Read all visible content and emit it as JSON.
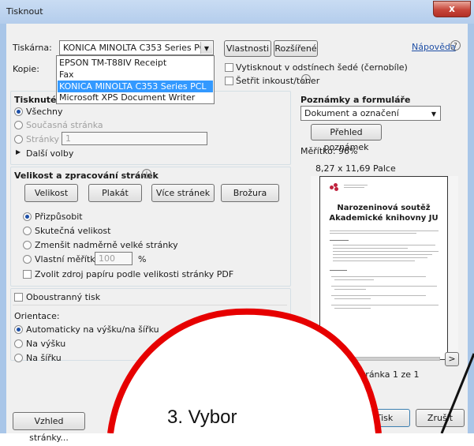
{
  "window": {
    "title": "Tisknout",
    "close": "x"
  },
  "printer": {
    "label": "Tiskárna:",
    "selected": "KONICA MINOLTA C353 Series PCL",
    "options": [
      "EPSON TM-T88IV Receipt",
      "Fax",
      "KONICA MINOLTA C353 Series PCL",
      "Microsoft XPS Document Writer"
    ],
    "properties_btn": "Vlastnosti",
    "advanced_btn": "Rozšířené",
    "help_link": "Nápověda",
    "help_icon": "?",
    "copies_label": "Kopie:",
    "grayscale": "Vytisknout v odstínech šedé (černobíle)",
    "save_ink": "Šetřit inkoust/toner",
    "info_icon": "i"
  },
  "print_range": {
    "header": "Tisknuté s",
    "all": "Všechny",
    "current": "Současná stránka",
    "pages": "Stránky",
    "pages_value": "1",
    "more": "Další volby"
  },
  "sizing": {
    "header": "Velikost a zpracování stránek",
    "info_icon": "i",
    "tabs": [
      "Velikost",
      "Plakát",
      "Více stránek",
      "Brožura"
    ],
    "fit": "Přizpůsobit",
    "actual": "Skutečná velikost",
    "shrink": "Zmenšit nadměrně velké stránky",
    "custom": "Vlastní měřítko:",
    "custom_value": "100",
    "custom_unit": "%",
    "paper_source": "Zvolit zdroj papíru podle velikosti stránky PDF"
  },
  "duplex": "Oboustranný tisk",
  "orientation": {
    "label": "Orientace:",
    "auto": "Automaticky na výšku/na šířku",
    "portrait": "Na výšku",
    "landscape": "Na šířku"
  },
  "comments": {
    "header": "Poznámky a formuláře",
    "selected": "Dokument a označení",
    "summary_btn": "Přehled poznámek"
  },
  "preview": {
    "scale": "Měřítko: 96%",
    "size": "8,27 x 11,69 Palce",
    "title_line1": "Narozeninová soutěž",
    "title_line2": "Akademické knihovny JU",
    "page_info": "Stránka 1 ze 1",
    "prev": "<",
    "next": ">"
  },
  "buttons": {
    "page_setup": "Vzhled stránky...",
    "print": "Tisk",
    "cancel": "Zrušit"
  },
  "overlay": {
    "text": "3. Vybor",
    "color": "#e60000"
  }
}
